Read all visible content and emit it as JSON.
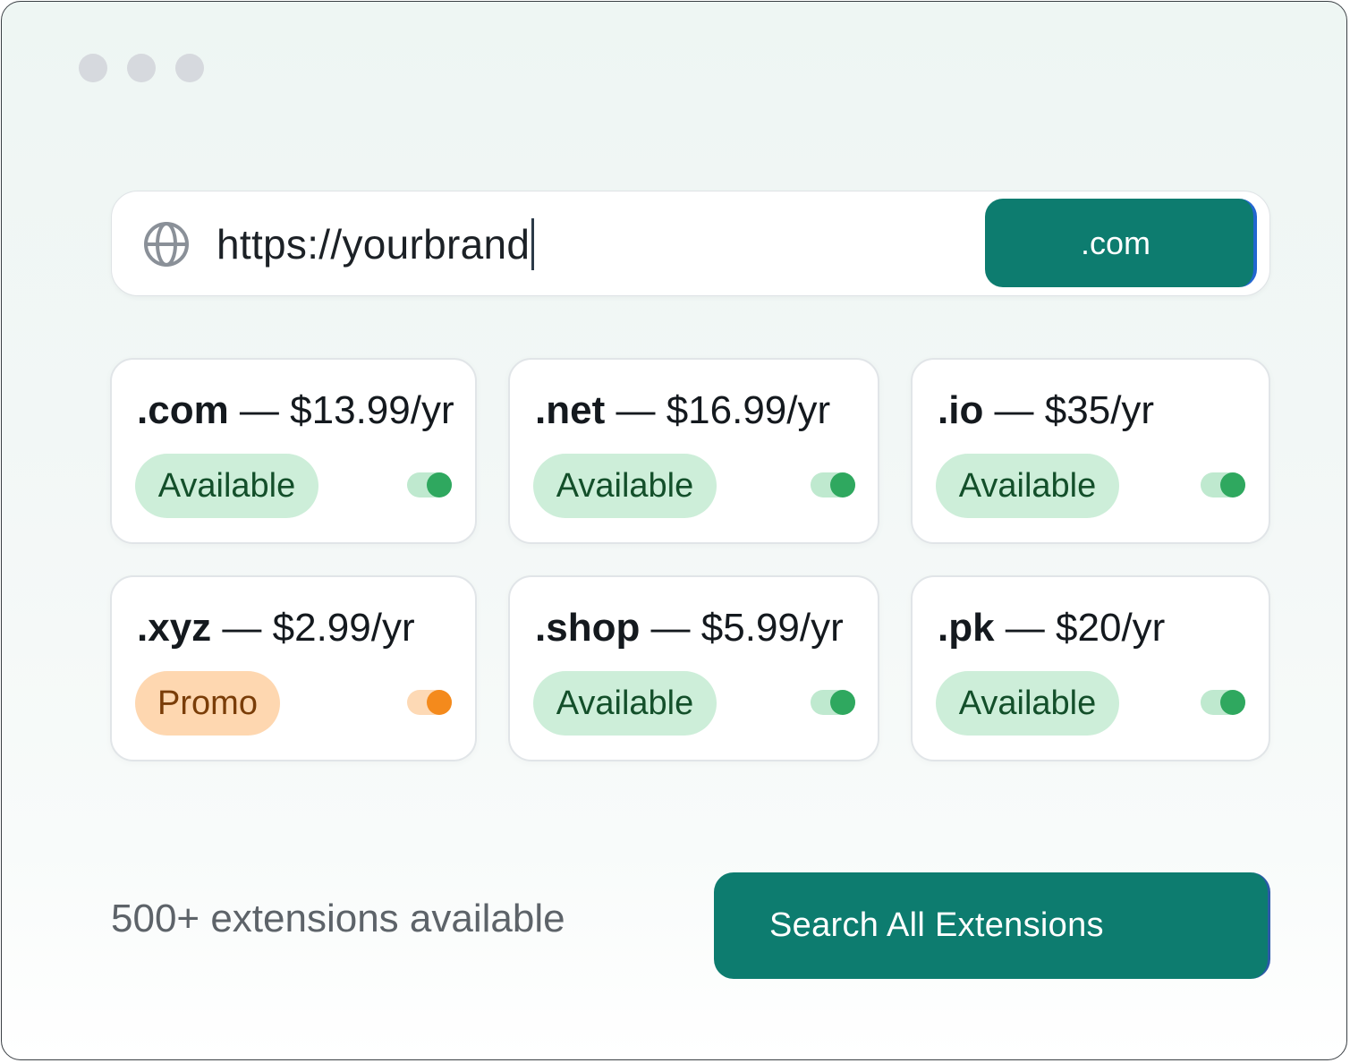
{
  "browser": {
    "window_controls": [
      "dot",
      "dot",
      "dot"
    ]
  },
  "urlbar": {
    "icon": "globe-icon",
    "value": "https://yourbrand",
    "tld_selected": ".com"
  },
  "cards": [
    {
      "tld": ".com",
      "separator": " — ",
      "price": "$13.99/yr",
      "status": "Available",
      "status_color": "#cdeed9",
      "toggle_color": "#2fa85f",
      "enabled": true
    },
    {
      "tld": ".net",
      "separator": " — ",
      "price": "$16.99/yr",
      "status": "Available",
      "status_color": "#cdeed9",
      "toggle_color": "#2fa85f",
      "enabled": true
    },
    {
      "tld": ".io",
      "separator": " — ",
      "price": "$35/yr",
      "status": "Available",
      "status_color": "#cdeed9",
      "toggle_color": "#2fa85f",
      "enabled": true
    },
    {
      "tld": ".xyz",
      "separator": " — ",
      "price": "$2.99/yr",
      "status": "Promo",
      "status_color": "#fed7b0",
      "toggle_color": "#f48a1c",
      "enabled": true
    },
    {
      "tld": ".shop",
      "separator": " — ",
      "price": "$5.99/yr",
      "status": "Available",
      "status_color": "#cdeed9",
      "toggle_color": "#2fa85f",
      "enabled": true
    },
    {
      "tld": ".pk",
      "separator": " — ",
      "price": "$20/yr",
      "status": "Available",
      "status_color": "#cdeed9",
      "toggle_color": "#2fa85f",
      "enabled": true
    }
  ],
  "footer": {
    "count_text": "500+ extensions available",
    "search_button": "Search All Extensions"
  },
  "colors": {
    "accent": "#0d7c6f",
    "available": "#2fa85f",
    "promo": "#f48a1c"
  }
}
